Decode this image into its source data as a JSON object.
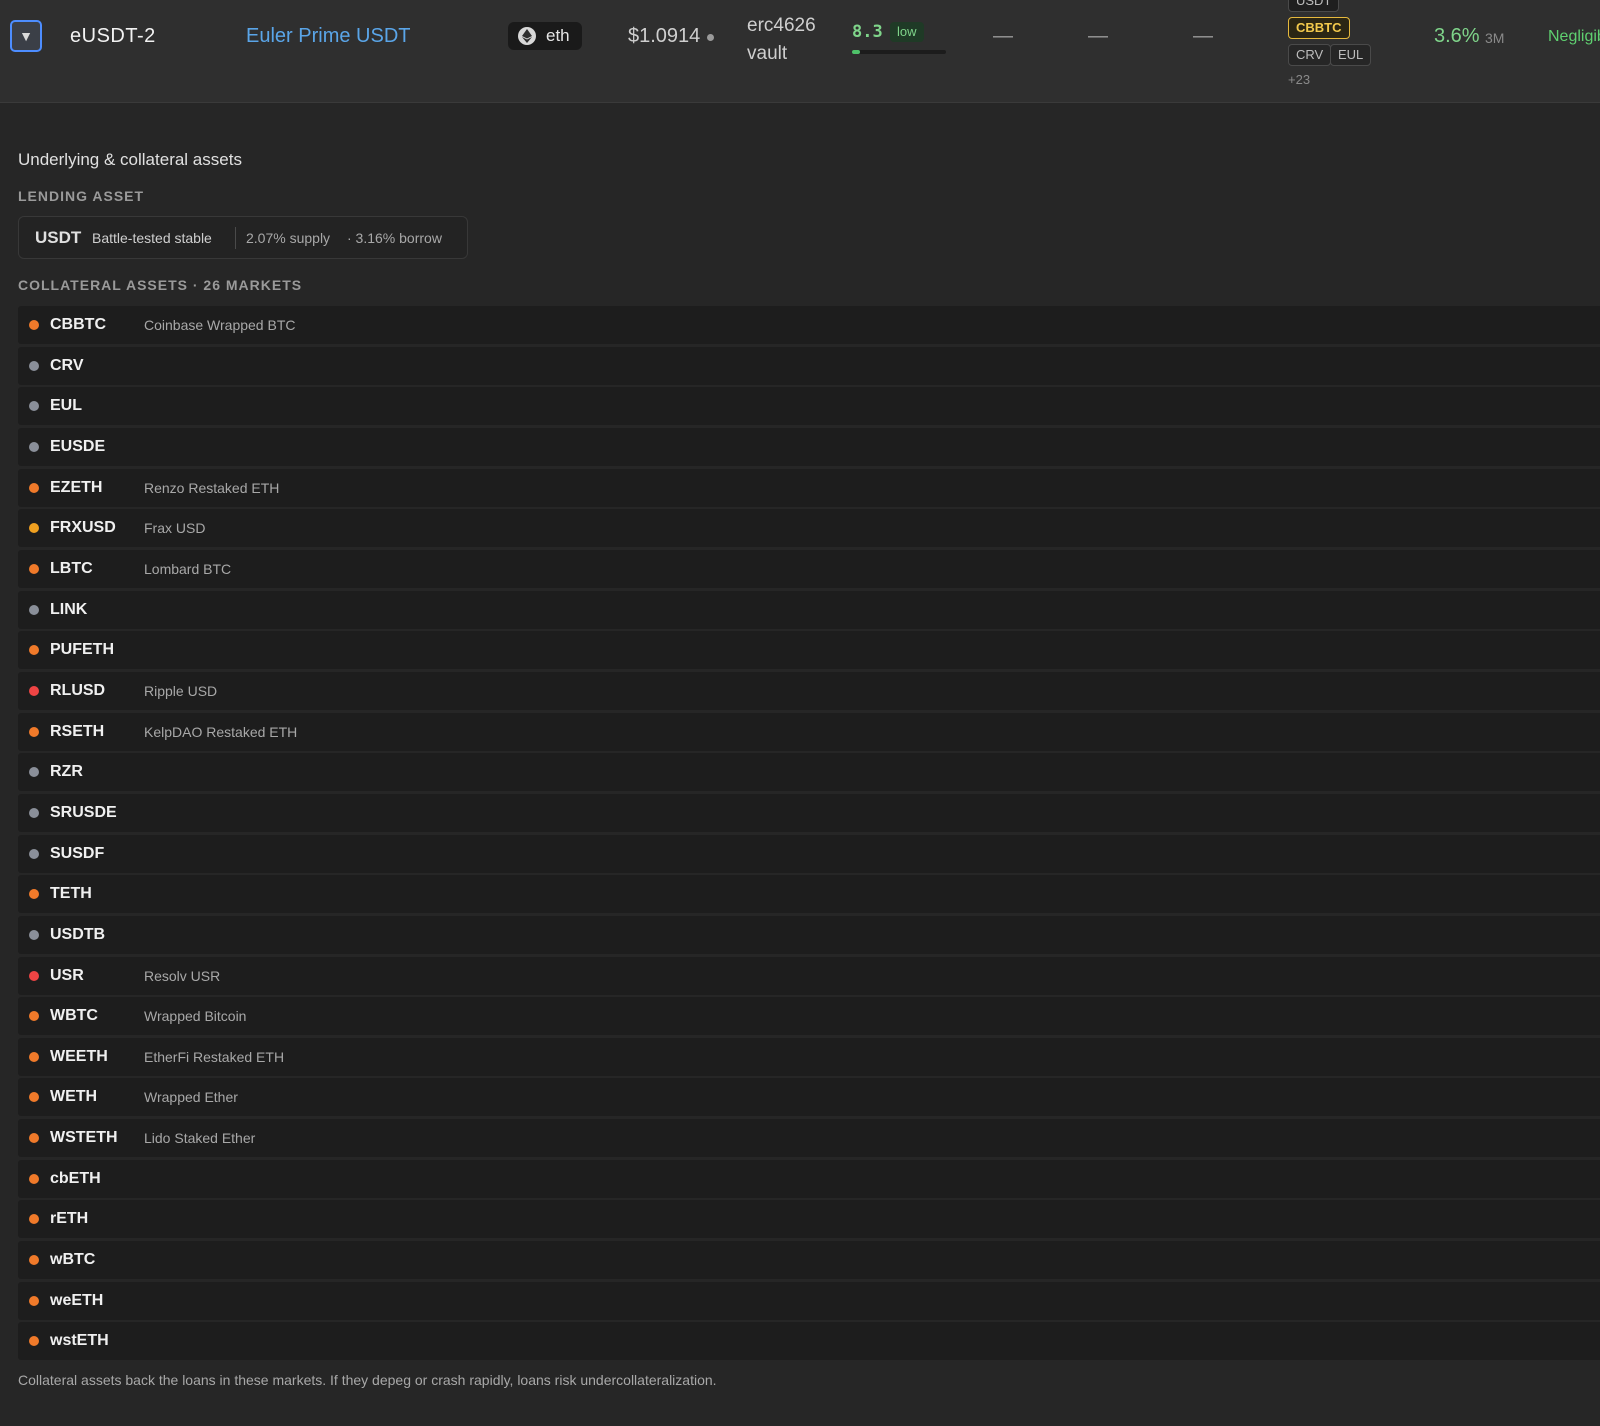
{
  "vault": {
    "toggle_icon": "▼",
    "id": "eUSDT-2",
    "name": "Euler Prime USDT",
    "chain": "eth",
    "chain_icon": "eth-icon",
    "price": "$1.0914",
    "type_line1": "erc4626",
    "type_line2": "vault",
    "score": "8.3",
    "score_label": "low",
    "score_fraction": 0.083,
    "dash1": "—",
    "dash2": "—",
    "dash3": "—",
    "tags": {
      "top": "USDT",
      "highlight": "CBBTC",
      "t1": "CRV",
      "t2": "EUL",
      "more": "+23"
    },
    "apy": "3.6%",
    "apy_period": "3M",
    "risk": "Negligib"
  },
  "details": {
    "title": "Underlying & collateral assets",
    "lending_label": "LENDING ASSET",
    "lending": {
      "symbol": "USDT",
      "desc": "Battle-tested stable",
      "supply": "2.07% supply",
      "borrow": "· 3.16% borrow"
    },
    "collateral_label": "COLLATERAL ASSETS · 26 MARKETS",
    "collateral": [
      {
        "symbol": "CBBTC",
        "name": "Coinbase Wrapped BTC",
        "color": "#f07a2a"
      },
      {
        "symbol": "CRV",
        "name": "",
        "color": "#8a8f99"
      },
      {
        "symbol": "EUL",
        "name": "",
        "color": "#8a8f99"
      },
      {
        "symbol": "EUSDE",
        "name": "",
        "color": "#8a8f99"
      },
      {
        "symbol": "EZETH",
        "name": "Renzo Restaked ETH",
        "color": "#f07a2a"
      },
      {
        "symbol": "FRXUSD",
        "name": "Frax USD",
        "color": "#f0a020"
      },
      {
        "symbol": "LBTC",
        "name": "Lombard BTC",
        "color": "#f07a2a"
      },
      {
        "symbol": "LINK",
        "name": "",
        "color": "#8a8f99"
      },
      {
        "symbol": "PUFETH",
        "name": "",
        "color": "#f07a2a"
      },
      {
        "symbol": "RLUSD",
        "name": "Ripple USD",
        "color": "#ef4444"
      },
      {
        "symbol": "RSETH",
        "name": "KelpDAO Restaked ETH",
        "color": "#f07a2a"
      },
      {
        "symbol": "RZR",
        "name": "",
        "color": "#8a8f99"
      },
      {
        "symbol": "SRUSDE",
        "name": "",
        "color": "#8a8f99"
      },
      {
        "symbol": "SUSDF",
        "name": "",
        "color": "#8a8f99"
      },
      {
        "symbol": "TETH",
        "name": "",
        "color": "#f07a2a"
      },
      {
        "symbol": "USDTB",
        "name": "",
        "color": "#8a8f99"
      },
      {
        "symbol": "USR",
        "name": "Resolv USR",
        "color": "#ef4444"
      },
      {
        "symbol": "WBTC",
        "name": "Wrapped Bitcoin",
        "color": "#f07a2a"
      },
      {
        "symbol": "WEETH",
        "name": "EtherFi Restaked ETH",
        "color": "#f07a2a"
      },
      {
        "symbol": "WETH",
        "name": "Wrapped Ether",
        "color": "#f07a2a"
      },
      {
        "symbol": "WSTETH",
        "name": "Lido Staked Ether",
        "color": "#f07a2a"
      },
      {
        "symbol": "cbETH",
        "name": "",
        "color": "#f07a2a"
      },
      {
        "symbol": "rETH",
        "name": "",
        "color": "#f07a2a"
      },
      {
        "symbol": "wBTC",
        "name": "",
        "color": "#f07a2a"
      },
      {
        "symbol": "weETH",
        "name": "",
        "color": "#f07a2a"
      },
      {
        "symbol": "wstETH",
        "name": "",
        "color": "#f07a2a"
      }
    ],
    "footnote": "Collateral assets back the loans in these markets. If they depeg or crash rapidly, loans risk undercollateralization."
  }
}
